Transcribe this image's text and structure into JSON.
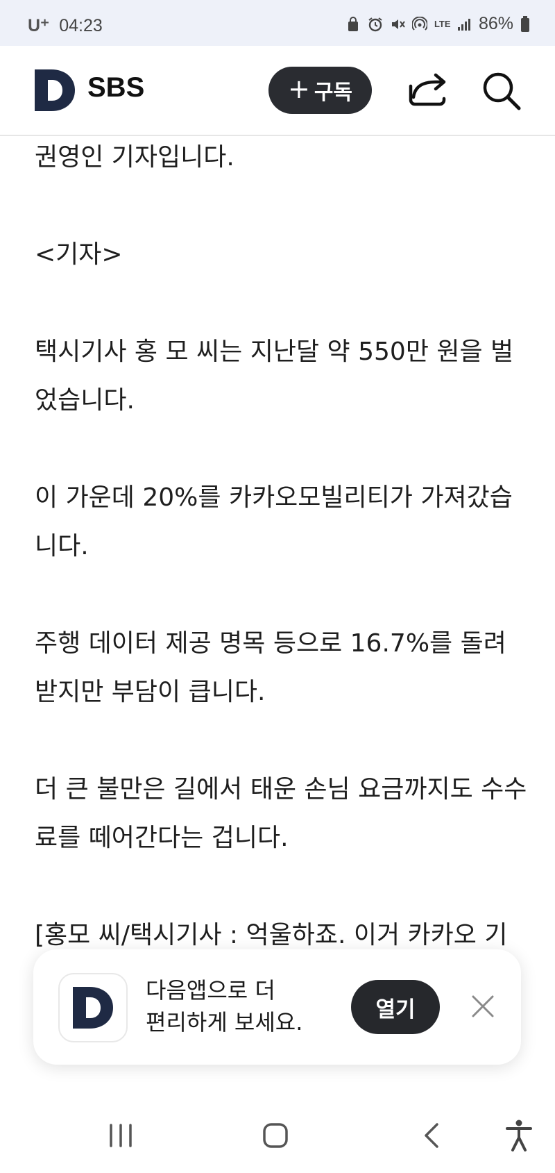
{
  "status_bar": {
    "carrier": "U⁺",
    "time": "04:23",
    "network": "LTE",
    "battery": "86%"
  },
  "header": {
    "logo_letter": "D",
    "brand": "SBS",
    "subscribe_plus": "+",
    "subscribe_label": "구독"
  },
  "article": {
    "paragraphs": [
      "권영인 기자입니다.",
      "<기자>",
      "택시기사 홍 모 씨는 지난달 약 550만 원을 벌었습니다.",
      "이 가운데 20%를 카카오모빌리티가 가져갔습니다.",
      "주행 데이터 제공 명목 등으로 16.7%를 돌려받지만 부담이 큽니다.",
      "더 큰 불만은 길에서 태운 손님 요금까지도 수수료를 떼어간다는 겁니다.",
      "[홍모 씨/택시기사 : 억울하죠. 이거 카카오 기사를 안 했을 때 벌은 건 말이 안 되지.]"
    ]
  },
  "banner": {
    "logo_letter": "D",
    "line1": "다음앱으로 더",
    "line2": "편리하게 보세요.",
    "open_label": "열기"
  },
  "colors": {
    "status_bg": "#eef1f9",
    "logo_navy": "#1f2a44",
    "button_dark": "#2a2c31"
  }
}
